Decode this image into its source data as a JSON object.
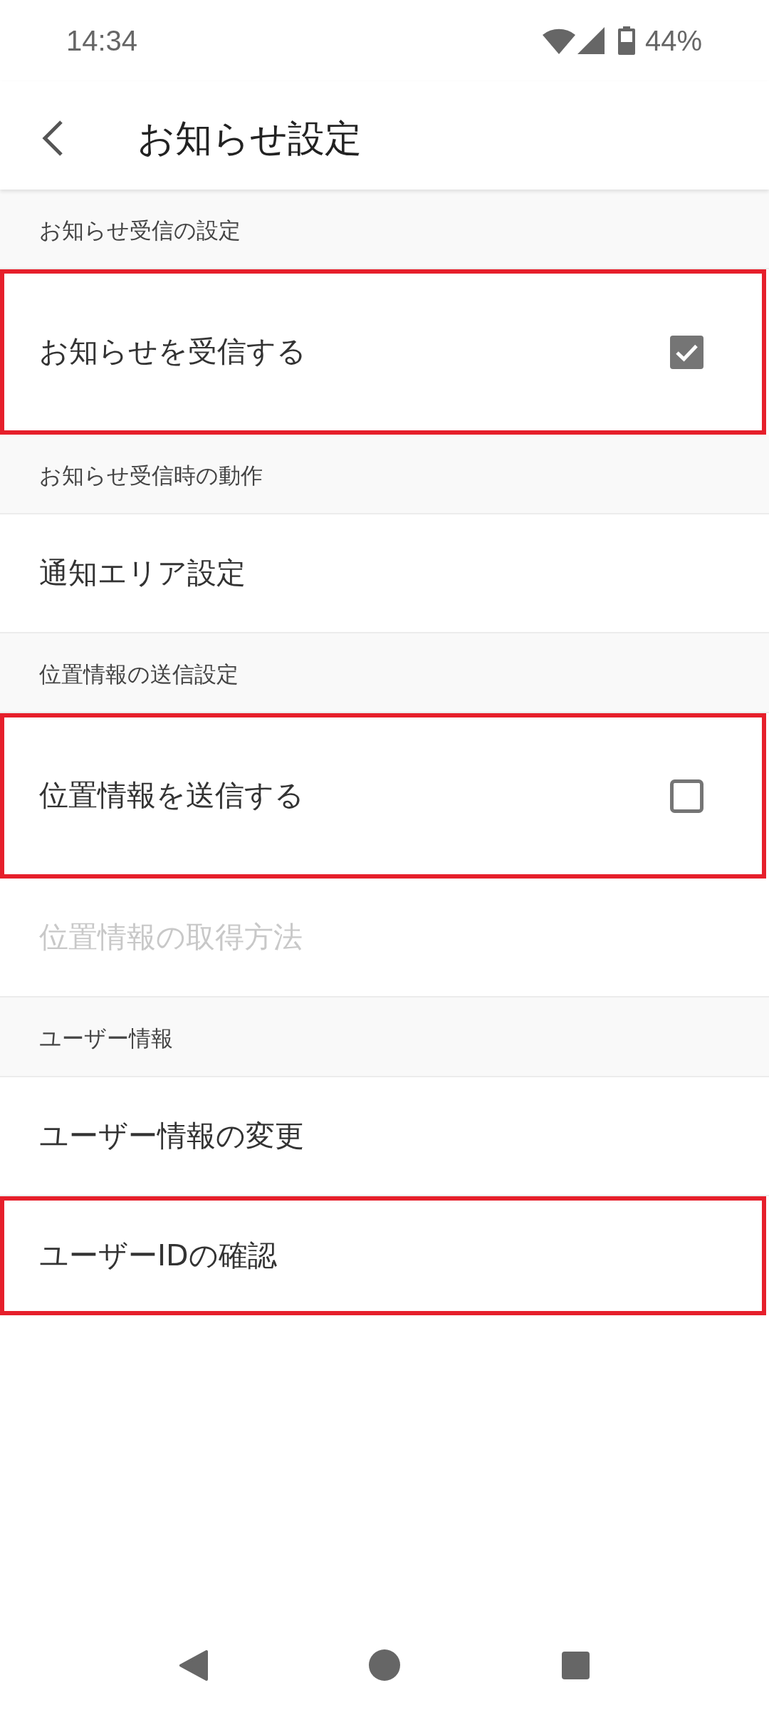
{
  "status_bar": {
    "time": "14:34",
    "battery": "44%"
  },
  "app_bar": {
    "title": "お知らせ設定"
  },
  "sections": [
    {
      "header": "お知らせ受信の設定",
      "items": [
        {
          "kind": "checkbox",
          "label": "お知らせを受信する",
          "checked": true,
          "disabled": false,
          "highlighted": true
        }
      ]
    },
    {
      "header": "お知らせ受信時の動作",
      "items": [
        {
          "kind": "link",
          "label": "通知エリア設定",
          "disabled": false,
          "highlighted": false
        }
      ]
    },
    {
      "header": "位置情報の送信設定",
      "items": [
        {
          "kind": "checkbox",
          "label": "位置情報を送信する",
          "checked": false,
          "disabled": false,
          "highlighted": true
        },
        {
          "kind": "link",
          "label": "位置情報の取得方法",
          "disabled": true,
          "highlighted": false
        }
      ]
    },
    {
      "header": "ユーザー情報",
      "items": [
        {
          "kind": "link",
          "label": "ユーザー情報の変更",
          "disabled": false,
          "highlighted": false
        },
        {
          "kind": "link",
          "label": "ユーザーIDの確認",
          "disabled": false,
          "highlighted": true
        }
      ]
    }
  ]
}
